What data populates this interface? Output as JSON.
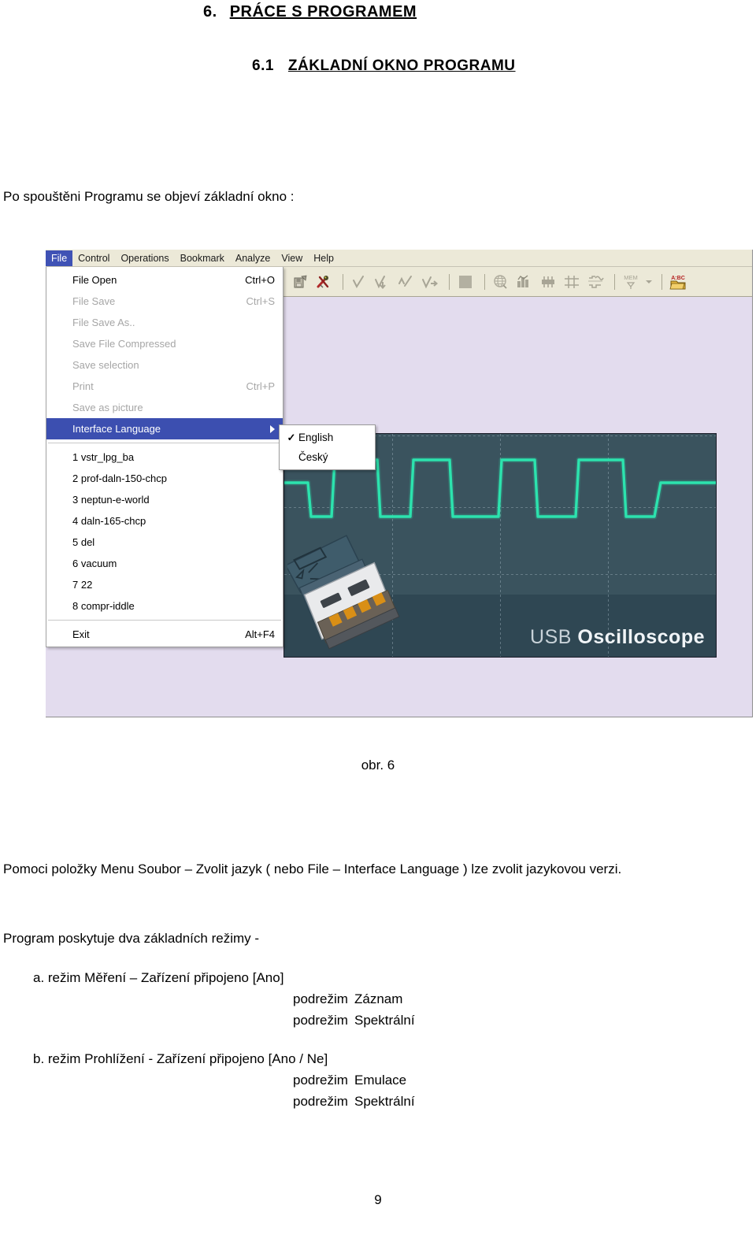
{
  "document": {
    "heading1": {
      "number": "6.",
      "text": "PRÁCE  S  PROGRAMEM"
    },
    "heading2": {
      "number": "6.1",
      "text": "ZÁKLADNÍ  OKNO  PROGRAMU"
    },
    "intro": "Po spouštěni Programu se objeví základní okno :",
    "figure_caption": "obr. 6",
    "para_1": "Pomoci položky Menu Soubor – Zvolit jazyk ( nebo File – Interface Language ) lze zvolit jazykovou verzi.",
    "para_2": "Program poskytuje  dva základních režimy  -",
    "mode_a": {
      "title": "a. režim Měření – Zařízení připojeno [Ano]",
      "sub_label_1": "podrežim",
      "sub_value_1": "Záznam",
      "sub_label_2": "podrežim",
      "sub_value_2": "Spektrální"
    },
    "mode_b": {
      "title": "b. režim Prohlížení - Zařízení připojeno [Ano / Ne]",
      "sub_label_1": "podrežim",
      "sub_value_1": "Emulace",
      "sub_label_2": "podrežim",
      "sub_value_2": "Spektrální"
    },
    "page_number": "9"
  },
  "app": {
    "menubar": [
      {
        "label": "File",
        "active": true
      },
      {
        "label": "Control",
        "active": false
      },
      {
        "label": "Operations",
        "active": false
      },
      {
        "label": "Bookmark",
        "active": false
      },
      {
        "label": "Analyze",
        "active": false
      },
      {
        "label": "View",
        "active": false
      },
      {
        "label": "Help",
        "active": false
      }
    ],
    "toolbar": {
      "buttons": [
        {
          "icon": "open-file-icon",
          "enabled": true
        },
        {
          "icon": "tools-wrench-icon",
          "enabled": true
        },
        {
          "sep": true
        },
        {
          "icon": "waveform-check-icon",
          "enabled": false
        },
        {
          "icon": "waveform-down-icon",
          "enabled": false
        },
        {
          "icon": "waveform-up-icon",
          "enabled": false
        },
        {
          "icon": "waveform-right-icon",
          "enabled": false
        },
        {
          "sep": true
        },
        {
          "icon": "stop-square-icon",
          "enabled": false
        },
        {
          "sep": true
        },
        {
          "icon": "globe-icon",
          "enabled": false
        },
        {
          "icon": "histogram-icon",
          "enabled": false
        },
        {
          "icon": "filter-icon",
          "enabled": false
        },
        {
          "icon": "axis-icon",
          "enabled": false
        },
        {
          "icon": "signal-steps-icon",
          "enabled": false
        },
        {
          "sep": true
        },
        {
          "icon": "mem-icon",
          "label": "MEM",
          "enabled": false
        },
        {
          "icon": "chevron-down-icon",
          "enabled": false
        },
        {
          "sep": true
        },
        {
          "icon": "abc-folder-icon",
          "enabled": true
        }
      ]
    },
    "file_menu": {
      "items": [
        {
          "label": "File Open",
          "accel": "Ctrl+O",
          "enabled": true
        },
        {
          "label": "File Save",
          "accel": "Ctrl+S",
          "enabled": false
        },
        {
          "label": "File Save As..",
          "accel": "",
          "enabled": false
        },
        {
          "label": "Save File Compressed",
          "accel": "",
          "enabled": false
        },
        {
          "label": "Save selection",
          "accel": "",
          "enabled": false
        },
        {
          "label": "Print",
          "accel": "Ctrl+P",
          "enabled": false
        },
        {
          "label": "Save as picture",
          "accel": "",
          "enabled": false
        },
        {
          "label": "Interface Language",
          "accel": "",
          "enabled": true,
          "highlight": true,
          "has_submenu": true
        }
      ],
      "recent_files": [
        "1 vstr_lpg_ba",
        "2 prof-daln-150-chcp",
        "3 neptun-e-world",
        "4 daln-165-chcp",
        "5 del",
        "6 vacuum",
        "7 22",
        "8 compr-iddle"
      ],
      "exit": {
        "label": "Exit",
        "accel": "Alt+F4"
      }
    },
    "language_submenu": {
      "items": [
        {
          "label": "English",
          "checked": true
        },
        {
          "label": "Český",
          "checked": false
        }
      ]
    },
    "splash": {
      "brand_light": "USB",
      "brand_bold": "Oscilloscope"
    },
    "colors": {
      "menubar_bg": "#ece9d8",
      "menu_highlight": "#3c4fb0",
      "client_bg": "#e3dcee",
      "splash_bg": "#34505c",
      "waveform": "#2ce3ae"
    }
  }
}
